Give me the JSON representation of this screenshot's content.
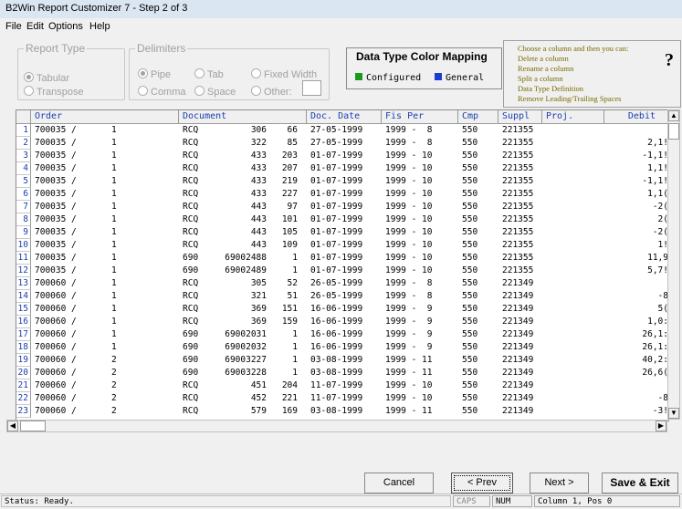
{
  "window": {
    "title": "B2Win Report Customizer 7 - Step 2 of 3"
  },
  "menu": [
    "File",
    "Edit",
    "Options",
    "Help"
  ],
  "report_type": {
    "legend": "Report Type",
    "options": [
      "Tabular",
      "Transpose"
    ],
    "selected": "Tabular"
  },
  "delimiters": {
    "legend": "Delimiters",
    "options": [
      "Pipe",
      "Tab",
      "Fixed Width",
      "Comma",
      "Space",
      "Other:"
    ],
    "selected": "Pipe",
    "other_value": ""
  },
  "data_type_map": {
    "title": "Data Type Color Mapping",
    "configured_label": "Configured",
    "general_label": "General",
    "configured_color": "#1a9a1a",
    "general_color": "#1a3fd0"
  },
  "help": {
    "lines": [
      "Choose a column and then you can:",
      "Delete a column",
      "Rename a column",
      "Split a column",
      "Data Type Definition",
      "Remove Leading/Trailing Spaces"
    ],
    "icon": "?"
  },
  "grid": {
    "headers": [
      "Order",
      "Document",
      "Doc. Date",
      "Fis Per",
      "Cmp",
      "Suppl",
      "Proj.",
      "Debit"
    ],
    "rows": [
      {
        "n": "1",
        "o": "700035 /",
        "o2": "1",
        "d": "RCQ",
        "d2": "306",
        "d3": "66",
        "date": "27-05-1999",
        "fp": "1999 -  8",
        "cmp": "550",
        "sup": "221355",
        "proj": "",
        "debit": ""
      },
      {
        "n": "2",
        "o": "700035 /",
        "o2": "1",
        "d": "RCQ",
        "d2": "322",
        "d3": "85",
        "date": "27-05-1999",
        "fp": "1999 -  8",
        "cmp": "550",
        "sup": "221355",
        "proj": "",
        "debit": "2,1!"
      },
      {
        "n": "3",
        "o": "700035 /",
        "o2": "1",
        "d": "RCQ",
        "d2": "433",
        "d3": "203",
        "date": "01-07-1999",
        "fp": "1999 - 10",
        "cmp": "550",
        "sup": "221355",
        "proj": "",
        "debit": "-1,1!"
      },
      {
        "n": "4",
        "o": "700035 /",
        "o2": "1",
        "d": "RCQ",
        "d2": "433",
        "d3": "207",
        "date": "01-07-1999",
        "fp": "1999 - 10",
        "cmp": "550",
        "sup": "221355",
        "proj": "",
        "debit": "1,1!"
      },
      {
        "n": "5",
        "o": "700035 /",
        "o2": "1",
        "d": "RCQ",
        "d2": "433",
        "d3": "219",
        "date": "01-07-1999",
        "fp": "1999 - 10",
        "cmp": "550",
        "sup": "221355",
        "proj": "",
        "debit": "-1,1!"
      },
      {
        "n": "6",
        "o": "700035 /",
        "o2": "1",
        "d": "RCQ",
        "d2": "433",
        "d3": "227",
        "date": "01-07-1999",
        "fp": "1999 - 10",
        "cmp": "550",
        "sup": "221355",
        "proj": "",
        "debit": "1,1("
      },
      {
        "n": "7",
        "o": "700035 /",
        "o2": "1",
        "d": "RCQ",
        "d2": "443",
        "d3": "97",
        "date": "01-07-1999",
        "fp": "1999 - 10",
        "cmp": "550",
        "sup": "221355",
        "proj": "",
        "debit": "-2("
      },
      {
        "n": "8",
        "o": "700035 /",
        "o2": "1",
        "d": "RCQ",
        "d2": "443",
        "d3": "101",
        "date": "01-07-1999",
        "fp": "1999 - 10",
        "cmp": "550",
        "sup": "221355",
        "proj": "",
        "debit": "2("
      },
      {
        "n": "9",
        "o": "700035 /",
        "o2": "1",
        "d": "RCQ",
        "d2": "443",
        "d3": "105",
        "date": "01-07-1999",
        "fp": "1999 - 10",
        "cmp": "550",
        "sup": "221355",
        "proj": "",
        "debit": "-2("
      },
      {
        "n": "10",
        "o": "700035 /",
        "o2": "1",
        "d": "RCQ",
        "d2": "443",
        "d3": "109",
        "date": "01-07-1999",
        "fp": "1999 - 10",
        "cmp": "550",
        "sup": "221355",
        "proj": "",
        "debit": "1!"
      },
      {
        "n": "11",
        "o": "700035 /",
        "o2": "1",
        "d": "690",
        "d2": "69002488",
        "d3": "1",
        "date": "01-07-1999",
        "fp": "1999 - 10",
        "cmp": "550",
        "sup": "221355",
        "proj": "",
        "debit": "11,9"
      },
      {
        "n": "12",
        "o": "700035 /",
        "o2": "1",
        "d": "690",
        "d2": "69002489",
        "d3": "1",
        "date": "01-07-1999",
        "fp": "1999 - 10",
        "cmp": "550",
        "sup": "221355",
        "proj": "",
        "debit": "5,7!"
      },
      {
        "n": "13",
        "o": "700060 /",
        "o2": "1",
        "d": "RCQ",
        "d2": "305",
        "d3": "52",
        "date": "26-05-1999",
        "fp": "1999 -  8",
        "cmp": "550",
        "sup": "221349",
        "proj": "",
        "debit": ""
      },
      {
        "n": "14",
        "o": "700060 /",
        "o2": "1",
        "d": "RCQ",
        "d2": "321",
        "d3": "51",
        "date": "26-05-1999",
        "fp": "1999 -  8",
        "cmp": "550",
        "sup": "221349",
        "proj": "",
        "debit": "-8"
      },
      {
        "n": "15",
        "o": "700060 /",
        "o2": "1",
        "d": "RCQ",
        "d2": "369",
        "d3": "151",
        "date": "16-06-1999",
        "fp": "1999 -  9",
        "cmp": "550",
        "sup": "221349",
        "proj": "",
        "debit": "5("
      },
      {
        "n": "16",
        "o": "700060 /",
        "o2": "1",
        "d": "RCQ",
        "d2": "369",
        "d3": "159",
        "date": "16-06-1999",
        "fp": "1999 -  9",
        "cmp": "550",
        "sup": "221349",
        "proj": "",
        "debit": "1,0:"
      },
      {
        "n": "17",
        "o": "700060 /",
        "o2": "1",
        "d": "690",
        "d2": "69002031",
        "d3": "1",
        "date": "16-06-1999",
        "fp": "1999 -  9",
        "cmp": "550",
        "sup": "221349",
        "proj": "",
        "debit": "26,1:"
      },
      {
        "n": "18",
        "o": "700060 /",
        "o2": "1",
        "d": "690",
        "d2": "69002032",
        "d3": "1",
        "date": "16-06-1999",
        "fp": "1999 -  9",
        "cmp": "550",
        "sup": "221349",
        "proj": "",
        "debit": "26,1:"
      },
      {
        "n": "19",
        "o": "700060 /",
        "o2": "2",
        "d": "690",
        "d2": "69003227",
        "d3": "1",
        "date": "03-08-1999",
        "fp": "1999 - 11",
        "cmp": "550",
        "sup": "221349",
        "proj": "",
        "debit": "40,2:"
      },
      {
        "n": "20",
        "o": "700060 /",
        "o2": "2",
        "d": "690",
        "d2": "69003228",
        "d3": "1",
        "date": "03-08-1999",
        "fp": "1999 - 11",
        "cmp": "550",
        "sup": "221349",
        "proj": "",
        "debit": "26,6("
      },
      {
        "n": "21",
        "o": "700060 /",
        "o2": "2",
        "d": "RCQ",
        "d2": "451",
        "d3": "204",
        "date": "11-07-1999",
        "fp": "1999 - 10",
        "cmp": "550",
        "sup": "221349",
        "proj": "",
        "debit": ""
      },
      {
        "n": "22",
        "o": "700060 /",
        "o2": "2",
        "d": "RCQ",
        "d2": "452",
        "d3": "221",
        "date": "11-07-1999",
        "fp": "1999 - 10",
        "cmp": "550",
        "sup": "221349",
        "proj": "",
        "debit": "-8"
      },
      {
        "n": "23",
        "o": "700060 /",
        "o2": "2",
        "d": "RCQ",
        "d2": "579",
        "d3": "169",
        "date": "03-08-1999",
        "fp": "1999 - 11",
        "cmp": "550",
        "sup": "221349",
        "proj": "",
        "debit": "-3!"
      }
    ]
  },
  "buttons": {
    "cancel": "Cancel",
    "prev": "< Prev",
    "next": "Next >",
    "save_exit": "Save & Exit"
  },
  "status": {
    "text": "Status: Ready.",
    "caps": "CAPS",
    "num": "NUM",
    "pos": "Column 1, Pos 0"
  }
}
